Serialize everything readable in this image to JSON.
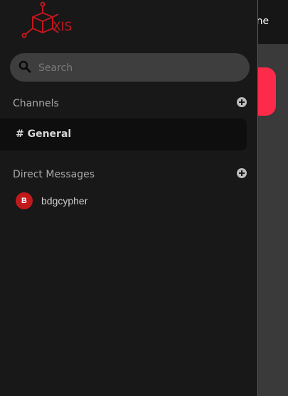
{
  "app": {
    "logo_text": "XIS",
    "header_status": "nline",
    "accent_color": "#e0213c"
  },
  "search": {
    "placeholder": "Search",
    "value": ""
  },
  "channels": {
    "title": "Channels",
    "items": [
      {
        "label": "# General",
        "selected": true
      }
    ]
  },
  "direct_messages": {
    "title": "Direct Messages",
    "items": [
      {
        "avatar_initial": "B",
        "name": "bdgcypher",
        "avatar_color": "#c0191c"
      }
    ]
  },
  "icons": {
    "search": "search-icon",
    "add_channel": "plus-circle-icon",
    "add_dm": "plus-circle-icon"
  }
}
